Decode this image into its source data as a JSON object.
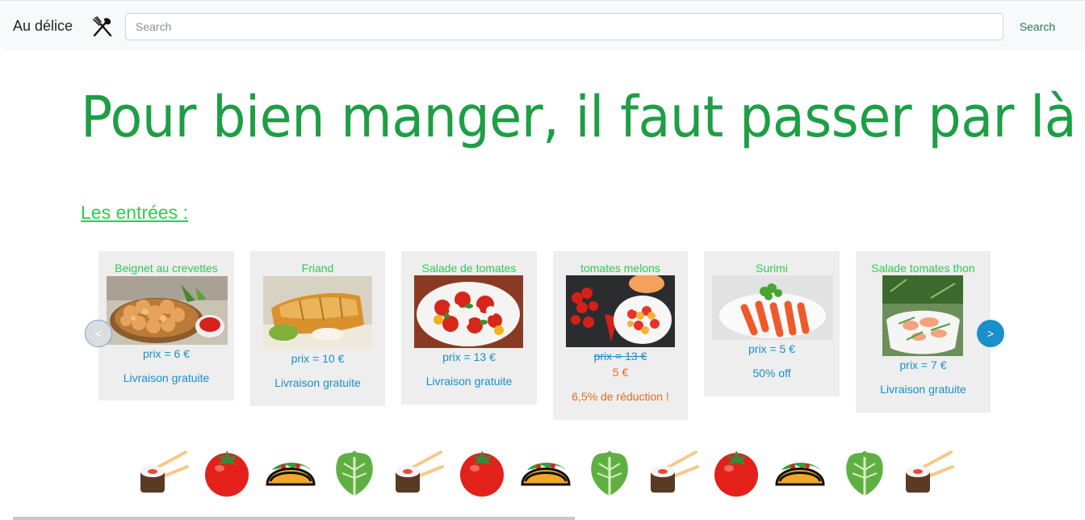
{
  "navbar": {
    "brand": "Au délice",
    "brand_icon": "fork-knife-icon",
    "search_placeholder": "Search",
    "search_button": "Search"
  },
  "hero": {
    "title": "Pour bien manger, il faut passer par là !"
  },
  "section": {
    "title": "Les entrées :"
  },
  "carousel": {
    "prev_label": "<",
    "next_label": ">",
    "items": [
      {
        "name": "Beignet au crevettes",
        "price": "prix = 6 €",
        "promo": "Livraison gratuite"
      },
      {
        "name": "Friand",
        "price": "prix = 10 €",
        "promo": "Livraison gratuite"
      },
      {
        "name": "Salade de tomates",
        "price": "prix = 13 €",
        "promo": "Livraison gratuite"
      },
      {
        "name": "tomates melons",
        "old_price": "prix = 13 €",
        "new_price": "5 €",
        "discount": "6,5% de réduction !"
      },
      {
        "name": "Surimi",
        "price": "prix = 5 €",
        "promo": "50% off"
      },
      {
        "name": "Salade tomates thon",
        "price": "prix = 7 €",
        "promo": "Livraison gratuite"
      }
    ]
  },
  "icon_strip": [
    "sushi-icon",
    "tomato-icon",
    "taco-icon",
    "lettuce-icon",
    "sushi-icon",
    "tomato-icon",
    "taco-icon",
    "lettuce-icon",
    "sushi-icon",
    "tomato-icon",
    "taco-icon",
    "lettuce-icon",
    "sushi-icon"
  ],
  "colors": {
    "brand_green": "#1e9e45",
    "accent_blue": "#1a8fc9",
    "promo_orange": "#e46a1d"
  }
}
